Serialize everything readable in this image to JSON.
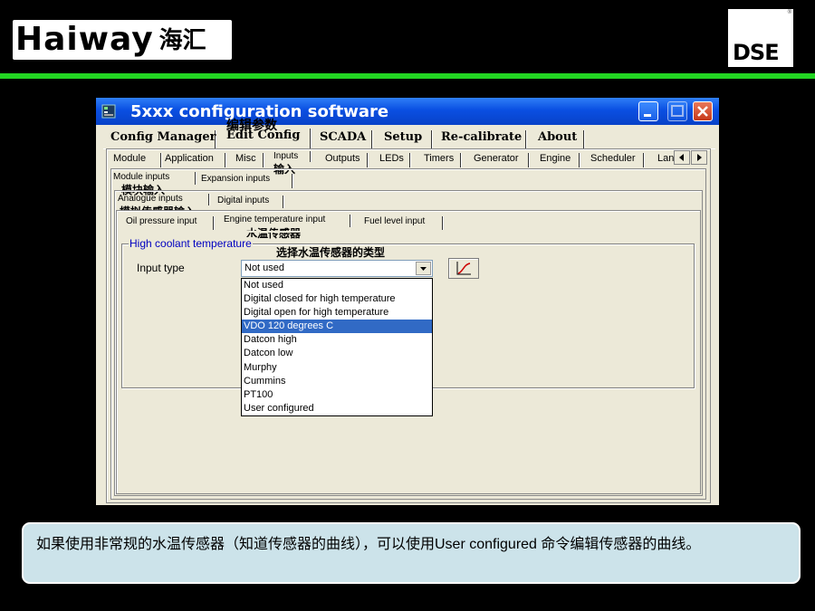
{
  "slide": {
    "logo_brand": "Haiway",
    "logo_cn": "海汇",
    "dse_logo": "DSE",
    "dse_reg": "®",
    "accent_color": "#22d622",
    "note": "如果使用非常规的水温传感器（知道传感器的曲线），可以使用User configured 命令编辑传感器的曲线。"
  },
  "window": {
    "title": "5xxx configuration software",
    "controls": {
      "minimize": "minimize-icon",
      "maximize": "maximize-icon",
      "close": "close-icon"
    }
  },
  "main_tabs": [
    "Config Manager",
    "Edit Config",
    "SCADA",
    "Setup",
    "Re-calibrate",
    "About"
  ],
  "edit_tabs": [
    "Module",
    "Application",
    "Misc",
    "Inputs",
    "Outputs",
    "LEDs",
    "Timers",
    "Generator",
    "Engine",
    "Scheduler",
    "Lang"
  ],
  "inputs_tabs": [
    "Module inputs",
    "Expansion inputs"
  ],
  "module_inputs_tabs": [
    "Analogue inputs",
    "Digital inputs"
  ],
  "analogue_tabs": [
    "Oil pressure input",
    "Engine temperature input",
    "Fuel level input"
  ],
  "annotations": {
    "edit_config": "编辑参数",
    "inputs": "输入",
    "module_inputs": "模块输入",
    "analogue_inputs": "模拟传感器输入",
    "engine_temp": "水温传感器",
    "select_type": "选择水温传感器的类型"
  },
  "group": {
    "title": "High coolant temperature",
    "input_type_label": "Input type",
    "selected": "Not used",
    "options": [
      "Not used",
      "Digital closed for high temperature",
      "Digital open for high temperature",
      "VDO 120 degrees C",
      "Datcon high",
      "Datcon low",
      "Murphy",
      "Cummins",
      "PT100",
      "User configured"
    ],
    "highlighted_index": 3,
    "highlight_color": "#316ac5"
  }
}
